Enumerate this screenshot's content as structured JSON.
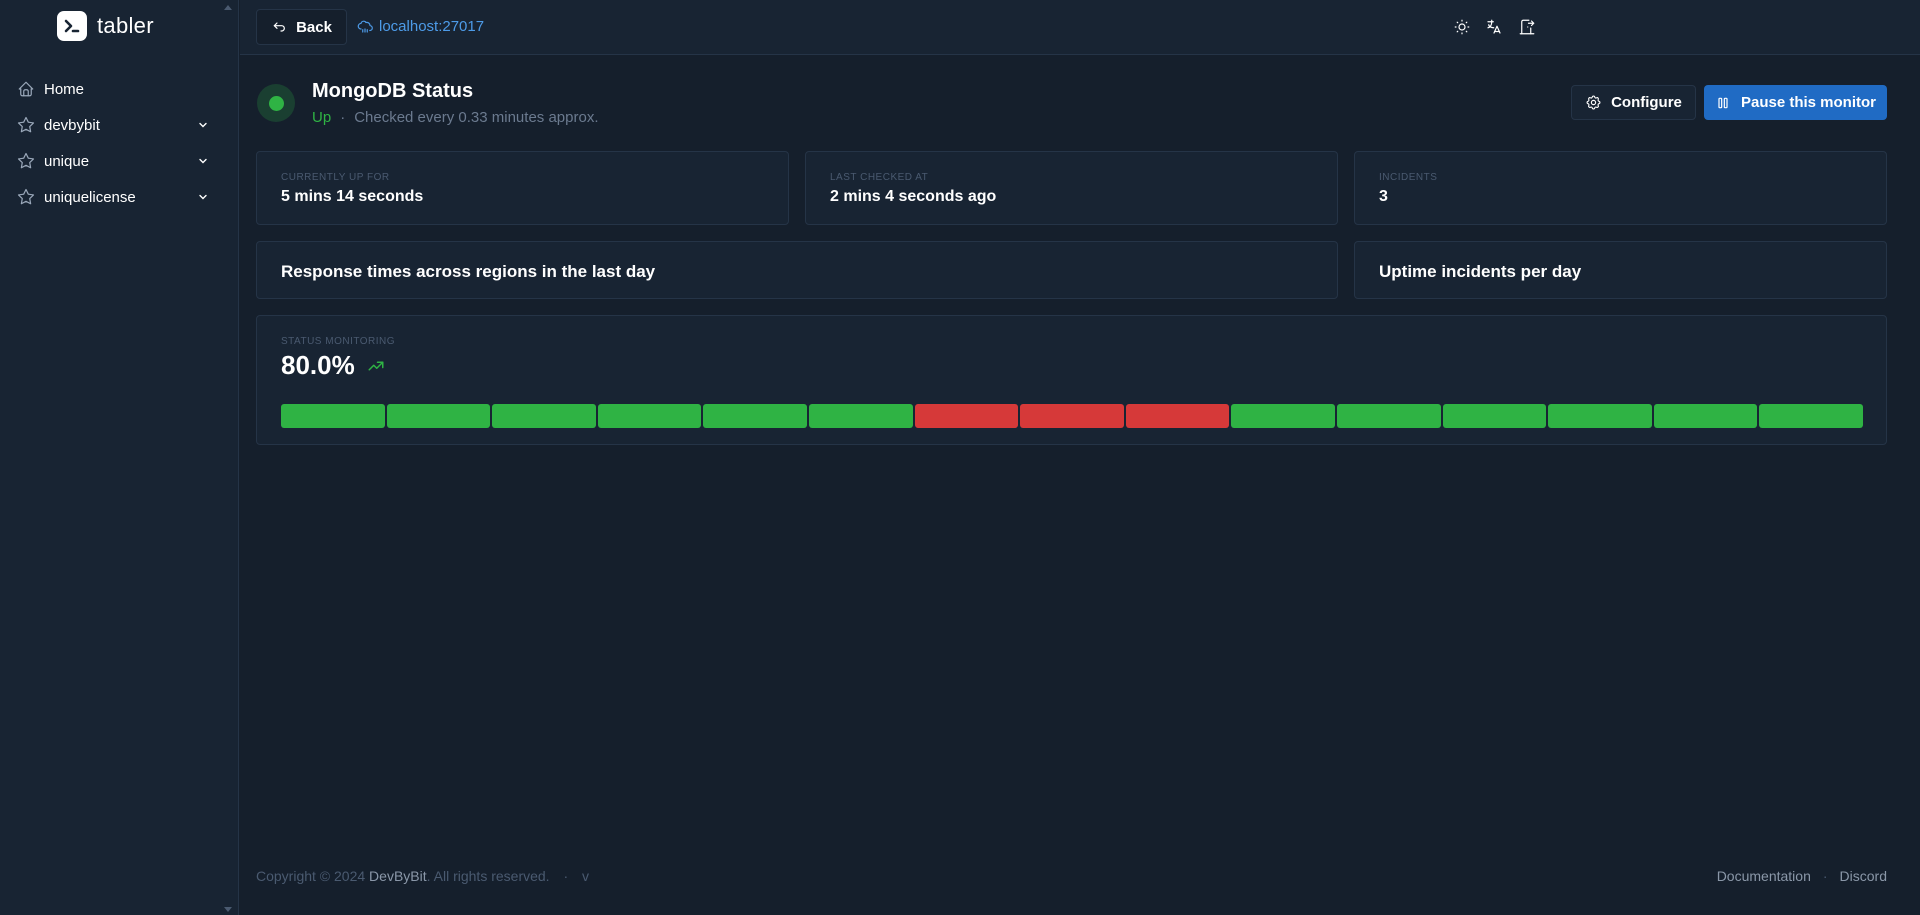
{
  "sidebar": {
    "brand": "tabler",
    "items": [
      {
        "label": "Home",
        "icon": "home-icon",
        "has_children": false
      },
      {
        "label": "devbybit",
        "icon": "star-icon",
        "has_children": true
      },
      {
        "label": "unique",
        "icon": "star-icon",
        "has_children": true
      },
      {
        "label": "uniquelicense",
        "icon": "star-icon",
        "has_children": true
      }
    ]
  },
  "header": {
    "back_label": "Back",
    "host": "localhost:27017",
    "icons": [
      "sun-icon",
      "language-icon",
      "logout-icon"
    ]
  },
  "monitor": {
    "title": "MongoDB Status",
    "status": "Up",
    "separator": "·",
    "check_text": "Checked every 0.33 minutes approx.",
    "configure_label": "Configure",
    "pause_label": "Pause this monitor"
  },
  "stats": [
    {
      "subheader": "CURRENTLY UP FOR",
      "value": "5 mins 14 seconds"
    },
    {
      "subheader": "LAST CHECKED AT",
      "value": "2 mins 4 seconds ago"
    },
    {
      "subheader": "INCIDENTS",
      "value": "3"
    }
  ],
  "panels": {
    "response_times_title": "Response times across regions in the last day",
    "uptime_incidents_title": "Uptime incidents per day"
  },
  "status_monitoring": {
    "subheader": "STATUS MONITORING",
    "value": "80.0%",
    "trend": "up",
    "tracking": [
      "up",
      "up",
      "up",
      "up",
      "up",
      "up",
      "down",
      "down",
      "down",
      "up",
      "up",
      "up",
      "up",
      "up",
      "up"
    ]
  },
  "colors": {
    "up": "#2fb344",
    "down": "#d63939",
    "primary": "#206bc4",
    "link": "#4d9be8"
  },
  "footer": {
    "copyright_prefix": "Copyright © 2024 ",
    "copyright_brand": "DevByBit",
    "copyright_suffix": ". All rights reserved.",
    "dot": "·",
    "version": "v",
    "links": [
      "Documentation",
      "Discord"
    ]
  }
}
